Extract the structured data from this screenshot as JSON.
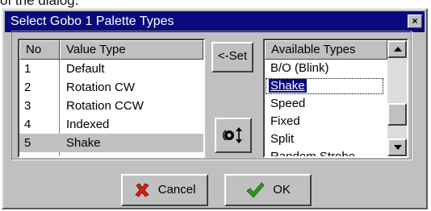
{
  "caption": {
    "text": "of the dialog."
  },
  "dialog": {
    "title": "Select Gobo 1 Palette Types",
    "close_glyph": "×"
  },
  "values_list": {
    "headers": {
      "no": "No",
      "value_type": "Value Type"
    },
    "rows": [
      {
        "no": "1",
        "type": "Default"
      },
      {
        "no": "2",
        "type": "Rotation CW"
      },
      {
        "no": "3",
        "type": "Rotation CCW"
      },
      {
        "no": "4",
        "type": "Indexed"
      },
      {
        "no": "5",
        "type": "Shake"
      }
    ],
    "selected_index": 4
  },
  "set_button": {
    "label": "<-Set"
  },
  "swap_button": {
    "icon": "swap-order-icon"
  },
  "types_list": {
    "header": "Available Types",
    "items": [
      "B/O (Blink)",
      "Shake",
      "Speed",
      "Fixed",
      "Split",
      "Random Strobe"
    ],
    "highlighted_index": 1
  },
  "footer": {
    "cancel_label": "Cancel",
    "ok_label": "OK",
    "cancel_icon": "red-x-icon",
    "ok_icon": "green-check-icon"
  },
  "colors": {
    "title_bar": "#0a0a7e",
    "face": "#c0c0c0",
    "cancel_icon": "#d42010",
    "ok_icon": "#2a9a1a"
  }
}
